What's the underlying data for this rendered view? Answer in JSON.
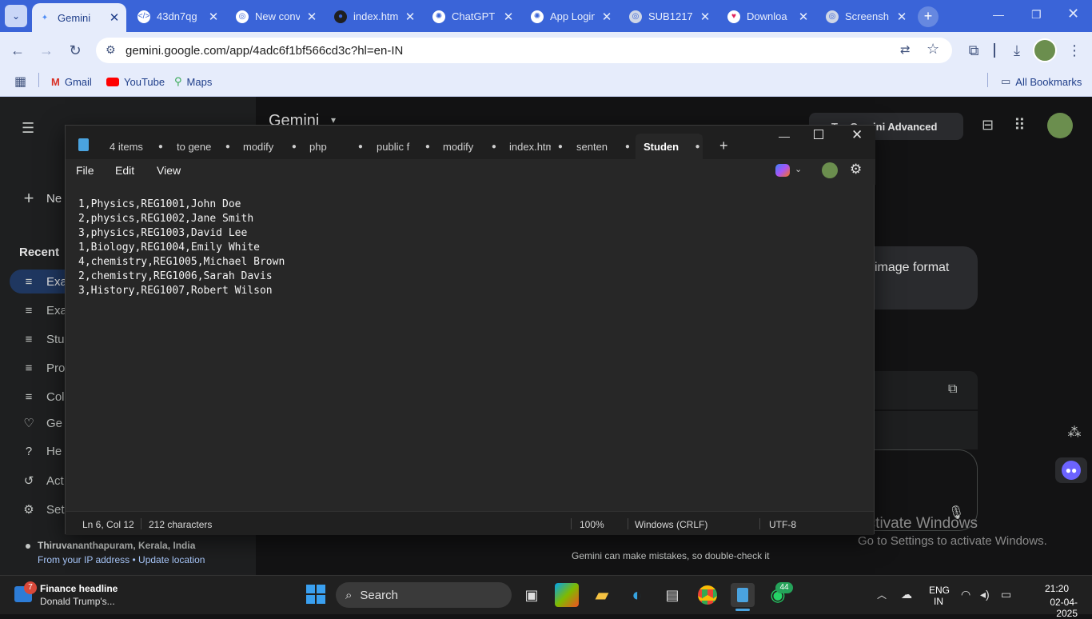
{
  "browser": {
    "tabs": [
      {
        "title": "Gemini",
        "icon": "gemini-sparkle-icon",
        "active": true
      },
      {
        "title": "43dn7qg",
        "icon": "code-icon"
      },
      {
        "title": "New conv",
        "icon": "copilot-icon"
      },
      {
        "title": "index.htm",
        "icon": "github-icon"
      },
      {
        "title": "ChatGPT |",
        "icon": "openai-icon"
      },
      {
        "title": "App Login",
        "icon": "openai-icon"
      },
      {
        "title": "SUB1217.",
        "icon": "globe-icon"
      },
      {
        "title": "Downloa",
        "icon": "heart-icon"
      },
      {
        "title": "Screensh",
        "icon": "globe-icon"
      }
    ],
    "url": "gemini.google.com/app/4adc6f1bf566cd3c?hl=en-IN",
    "bookmarks": [
      {
        "label": "Gmail",
        "icon": "gmail-icon"
      },
      {
        "label": "YouTube",
        "icon": "youtube-icon"
      },
      {
        "label": "Maps",
        "icon": "maps-icon"
      }
    ],
    "all_bookmarks": "All Bookmarks"
  },
  "gemini": {
    "title": "Gemini",
    "new_chat": "Ne",
    "recent_label": "Recent",
    "recent_items": [
      "Exa",
      "Exa",
      "Stu",
      "Pro",
      "Col"
    ],
    "nav_items": [
      {
        "label": "Ge",
        "icon": "gem-heart-icon"
      },
      {
        "label": "He",
        "icon": "help-icon"
      },
      {
        "label": "Act",
        "icon": "activity-icon"
      },
      {
        "label": "Set",
        "icon": "settings-icon"
      }
    ],
    "location": "Thiruvananthapuram, Kerala, India",
    "location_source": "From your IP address",
    "update_location": "Update location",
    "try_advanced": "Try Gemini Advanced",
    "chat_snippet": "image format",
    "disclaimer": "Gemini can make mistakes, so double-check it",
    "activate_title": "Activate Windows",
    "activate_sub": "Go to Settings to activate Windows."
  },
  "notepad": {
    "tabs": [
      "4 items",
      "to gene",
      "modify",
      "php",
      "public f",
      "modify",
      "index.html",
      "senten",
      "Studen"
    ],
    "active_tab": 8,
    "menu": {
      "file": "File",
      "edit": "Edit",
      "view": "View"
    },
    "lines": [
      "1,Physics,REG1001,John Doe",
      "2,physics,REG1002,Jane Smith",
      "3,physics,REG1003,David Lee",
      "1,Biology,REG1004,Emily White",
      "4,chemistry,REG1005,Michael Brown",
      "2,chemistry,REG1006,Sarah Davis",
      "3,History,REG1007,Robert Wilson"
    ],
    "status": {
      "position": "Ln 6, Col 12",
      "chars": "212 characters",
      "zoom": "100%",
      "line_ending": "Windows (CRLF)",
      "encoding": "UTF-8"
    }
  },
  "taskbar": {
    "news_badge": "7",
    "news_title": "Finance headline",
    "news_sub": "Donald Trump's...",
    "search": "Search",
    "whatsapp_badge": "44",
    "lang": "ENG",
    "lang_sub": "IN",
    "time": "21:20",
    "date": "02-04-2025"
  }
}
